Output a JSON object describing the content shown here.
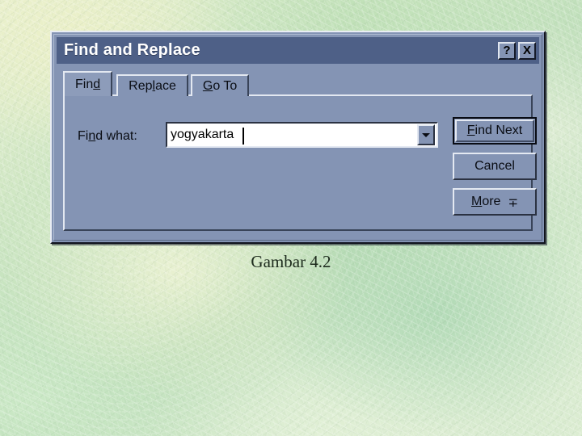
{
  "slide": {
    "caption": "Gambar 4.2",
    "background_color": "#cfe7c4"
  },
  "dialog": {
    "title": "Find and Replace",
    "titlebar_color": "#4e6087",
    "face_color": "#8494b4",
    "buttons": {
      "help_label": "?",
      "close_label": "X"
    },
    "tabs": [
      {
        "label": "Find",
        "active": true
      },
      {
        "label": "Replace",
        "active": false
      },
      {
        "label": "Go To",
        "active": false
      }
    ],
    "find_panel": {
      "find_what_label_pre": "Fi",
      "find_what_label_key": "n",
      "find_what_label_post": "d what:",
      "search_value": "yogyakarta",
      "search_placeholder": "",
      "dropdown_icon": "chevron-down-icon"
    },
    "commands": [
      {
        "label_pre": "",
        "label_key": "F",
        "label_post": "ind Next",
        "glyph": "",
        "default": true
      },
      {
        "label_pre": "",
        "label_key": "",
        "label_post": "Cancel",
        "glyph": "",
        "default": false
      },
      {
        "label_pre": "",
        "label_key": "M",
        "label_post": "ore",
        "glyph": "∓",
        "default": false
      }
    ]
  }
}
